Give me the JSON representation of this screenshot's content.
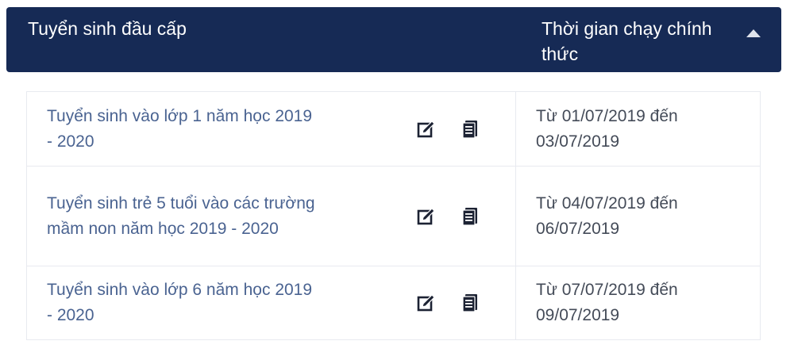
{
  "header": {
    "title": "Tuyển sinh đầu cấp",
    "time_column": "Thời gian chạy chính thức"
  },
  "rows": [
    {
      "name": "Tuyển sinh vào lớp 1 năm học 2019 - 2020",
      "time": "Từ 01/07/2019 đến 03/07/2019"
    },
    {
      "name": "Tuyển sinh trẻ 5 tuổi vào các trường mầm non năm học 2019 - 2020",
      "time": "Từ 04/07/2019 đến 06/07/2019"
    },
    {
      "name": "Tuyển sinh vào lớp 6 năm học 2019 - 2020",
      "time": "Từ 07/07/2019 đến 09/07/2019"
    }
  ],
  "icons": {
    "edit": "edit-icon",
    "document": "document-icon",
    "sort": "caret-up-icon"
  },
  "colors": {
    "header_bg": "#162a55",
    "link": "#4a6391",
    "text": "#444b58",
    "border": "#e8eaf0"
  }
}
